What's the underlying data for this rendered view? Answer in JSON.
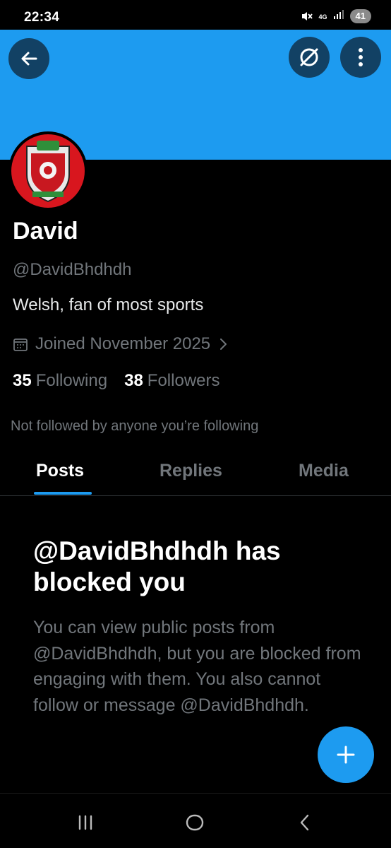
{
  "status_bar": {
    "time": "22:34",
    "network": "4G",
    "battery": "41",
    "icons": [
      "mute-icon",
      "signal-icon",
      "battery-icon"
    ]
  },
  "header": {
    "icons": [
      "back-arrow-icon",
      "globe-slash-icon",
      "more-vertical-icon"
    ]
  },
  "profile": {
    "display_name": "David",
    "handle": "@DavidBhdhdh",
    "bio": "Welsh, fan of most sports",
    "joined": "Joined November 2025",
    "following_count": "35",
    "following_label": "Following",
    "followers_count": "38",
    "followers_label": "Followers",
    "not_followed_text": "Not followed by anyone you’re following"
  },
  "tabs": [
    {
      "label": "Posts",
      "active": true
    },
    {
      "label": "Replies",
      "active": false
    },
    {
      "label": "Media",
      "active": false
    }
  ],
  "blocked": {
    "title": "@DavidBhdhdh has blocked you",
    "description": "You can view public posts from @DavidBhdhdh, but you are blocked from engaging with them. You also cannot follow or message @DavidBhdhdh."
  },
  "fab": {
    "icon": "plus-icon"
  },
  "nav_bar": {
    "icons": [
      "recent-apps-icon",
      "home-icon",
      "back-icon"
    ]
  },
  "colors": {
    "accent": "#1d9bf0",
    "background": "#000000",
    "text_primary": "#e7e9ea",
    "text_secondary": "#71767b"
  }
}
